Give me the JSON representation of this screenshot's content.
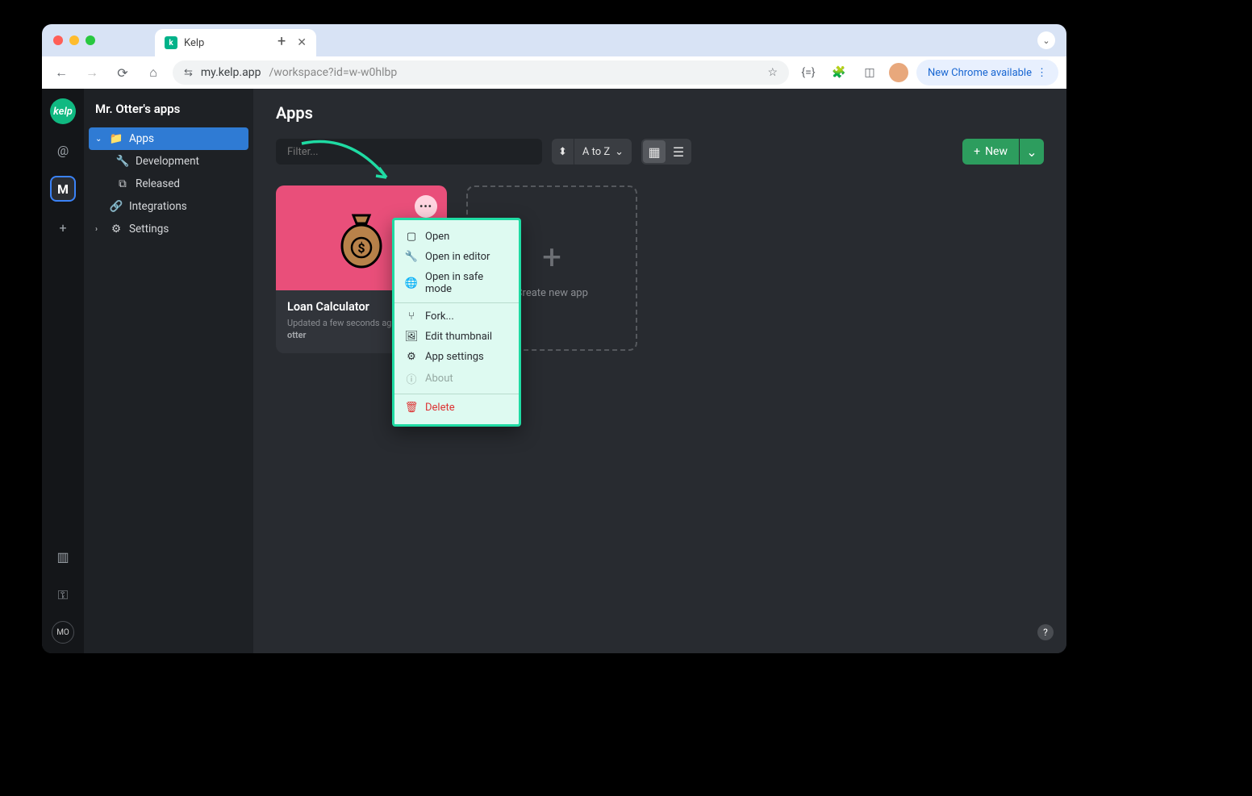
{
  "browser": {
    "tab_title": "Kelp",
    "url_host": "my.kelp.app",
    "url_path": "/workspace?id=w-w0hlbp",
    "update_label": "New Chrome available"
  },
  "rail": {
    "logo_text": "kelp",
    "at_label": "@",
    "workspace_initial": "M",
    "plus": "+",
    "user_initials": "MO"
  },
  "sidebar": {
    "workspace_title": "Mr. Otter's apps",
    "items": {
      "apps": "Apps",
      "development": "Development",
      "released": "Released",
      "integrations": "Integrations",
      "settings": "Settings"
    }
  },
  "main": {
    "title": "Apps",
    "filter_placeholder": "Filter...",
    "sort_label": "A to Z",
    "new_label": "New",
    "new_card_label": "Create new app"
  },
  "app_card": {
    "title": "Loan Calculator",
    "updated_prefix": "Updated a few seconds ago by ",
    "user": "otter"
  },
  "context_menu": {
    "open": "Open",
    "open_editor": "Open in editor",
    "open_safe": "Open in safe mode",
    "fork": "Fork...",
    "edit_thumb": "Edit thumbnail",
    "app_settings": "App settings",
    "about": "About",
    "delete": "Delete"
  }
}
